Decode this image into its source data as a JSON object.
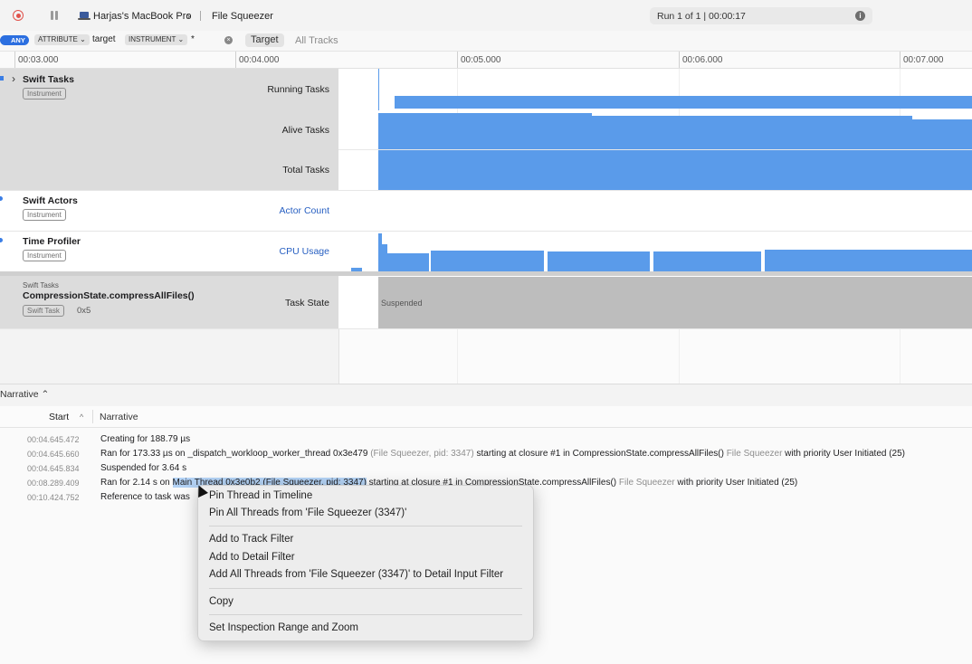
{
  "toolbar": {
    "device": "Harjas's MacBook Pro",
    "app": "File Squeezer",
    "run": "Run 1 of 1  |  00:00:17",
    "info_icon": "i"
  },
  "filter": {
    "any": "ANY",
    "attr_token": "ATTRIBUTE ⌄",
    "attr_value": "target",
    "inst_token": "INSTRUMENT ⌄",
    "inst_value": "*",
    "target_btn": "Target",
    "all_tracks_btn": "All Tracks"
  },
  "ruler": [
    "00:03.000",
    "00:04.000",
    "00:05.000",
    "00:06.000",
    "00:07.000"
  ],
  "tracks": {
    "swift_tasks": {
      "title": "Swift Tasks",
      "badge": "Instrument",
      "lanes": [
        "Running Tasks",
        "Alive Tasks",
        "Total Tasks"
      ]
    },
    "swift_actors": {
      "title": "Swift Actors",
      "badge": "Instrument",
      "lane": "Actor Count"
    },
    "time_profiler": {
      "title": "Time Profiler",
      "badge": "Instrument",
      "lane": "CPU Usage"
    },
    "task": {
      "kicker": "Swift Tasks",
      "title": "CompressionState.compressAllFiles()",
      "badge": "Swift Task",
      "id": "0x5",
      "lane": "Task State",
      "state": "Suspended"
    }
  },
  "narrative": {
    "selector": "Narrative ⌃",
    "col_start": "Start",
    "col_sort": "^",
    "col_narrative": "Narrative",
    "rows": [
      {
        "t": "00:04.645.472",
        "a": "Creating for 188.79 µs",
        "b": "",
        "c": "",
        "d": "",
        "e": ""
      },
      {
        "t": "00:04.645.660",
        "a": "Ran for 173.33 µs on _dispatch_workloop_worker_thread  0x3e479 ",
        "b": "(File Squeezer, pid: 3347)",
        "c": " starting at closure #1 in CompressionState.compressAllFiles() ",
        "d": "File Squeezer",
        "e": " with priority User Initiated (25)"
      },
      {
        "t": "00:04.645.834",
        "a": "Suspended for 3.64 s",
        "b": "",
        "c": "",
        "d": "",
        "e": ""
      },
      {
        "t": "00:08.289.409",
        "a": "Ran for 2.14 s on ",
        "b": "Main Thread  0x3e0b2 (File Squeezer, pid: 3347)",
        "c": " starting at closure #1 in CompressionState.compressAllFiles() ",
        "d": "File Squeezer",
        "e": " with priority User Initiated (25)"
      },
      {
        "t": "00:10.424.752",
        "a": "Reference to task was",
        "b": "",
        "c": "",
        "d": "",
        "e": ""
      }
    ]
  },
  "menu": {
    "items": [
      "Pin Thread in Timeline",
      "Pin All Threads from 'File Squeezer (3347)'",
      "Add to Track Filter",
      "Add to Detail Filter",
      "Add All Threads from 'File Squeezer (3347)' to Detail Input Filter",
      "Copy",
      "Set Inspection Range and Zoom"
    ]
  }
}
